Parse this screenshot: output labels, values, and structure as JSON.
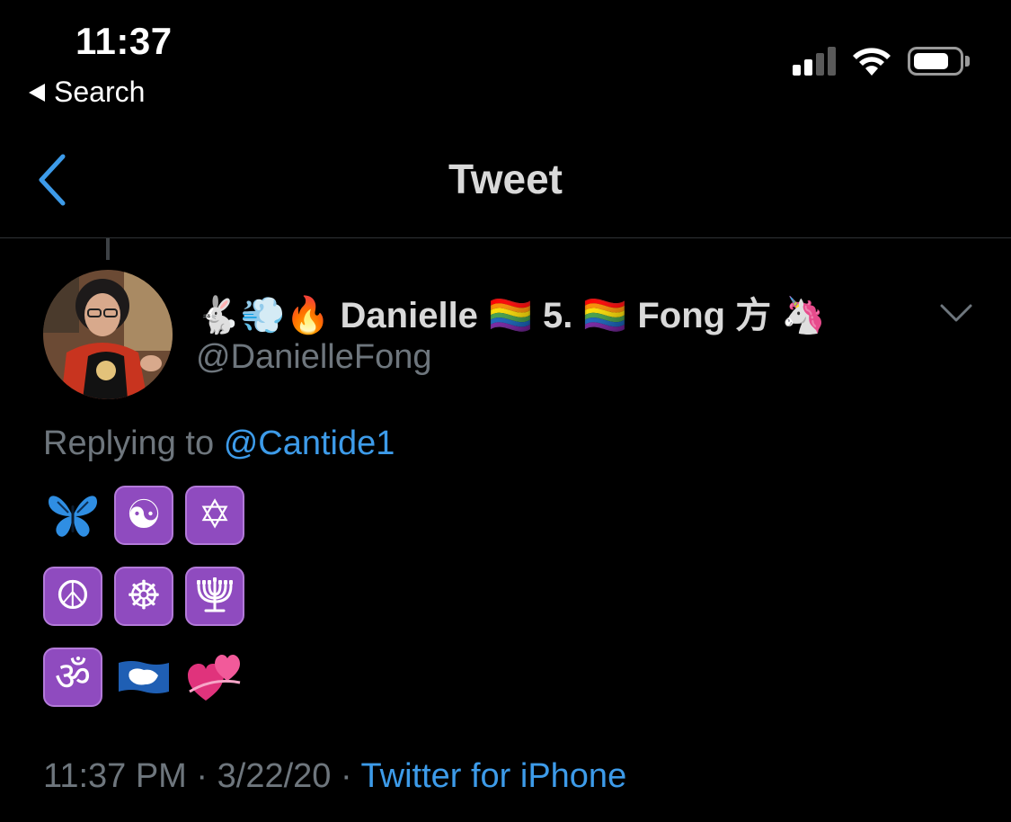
{
  "status_bar": {
    "time": "11:37",
    "back_to_app": "Search",
    "signal_bars_filled": 2,
    "signal_bars_total": 4
  },
  "nav": {
    "title": "Tweet",
    "back_icon": "chevron-left-icon"
  },
  "tweet": {
    "author": {
      "display_name": "🐇💨🔥 Danielle 🏳️‍🌈 5. 🏳️‍🌈 Fong 方 🦄",
      "handle": "@DanielleFong"
    },
    "replying_to_prefix": "Replying to",
    "replying_to_handle": "@Cantide1",
    "emoji_rows": [
      [
        {
          "name": "butterfly-emoji",
          "glyph": "🦋"
        },
        {
          "name": "yin-yang-emoji",
          "glyph": "☯"
        },
        {
          "name": "star-of-david-emoji",
          "glyph": "✡"
        }
      ],
      [
        {
          "name": "peace-symbol-emoji",
          "glyph": "☮"
        },
        {
          "name": "wheel-of-dharma-emoji",
          "glyph": "☸"
        },
        {
          "name": "menorah-emoji",
          "glyph": "🕎"
        }
      ],
      [
        {
          "name": "om-emoji",
          "glyph": "ॐ"
        },
        {
          "name": "antarctica-flag-emoji",
          "glyph": "🇦🇶"
        },
        {
          "name": "two-hearts-emoji",
          "glyph": "💞"
        }
      ]
    ],
    "time": "11:37 PM",
    "separator": "·",
    "date": "3/22/20",
    "source": "Twitter for iPhone"
  },
  "colors": {
    "background": "#000000",
    "text_primary": "#d9d9d9",
    "text_secondary": "#6e767d",
    "link": "#3d9be9",
    "divider": "#2f3336",
    "emoji_tile": "#8f4bbf"
  }
}
